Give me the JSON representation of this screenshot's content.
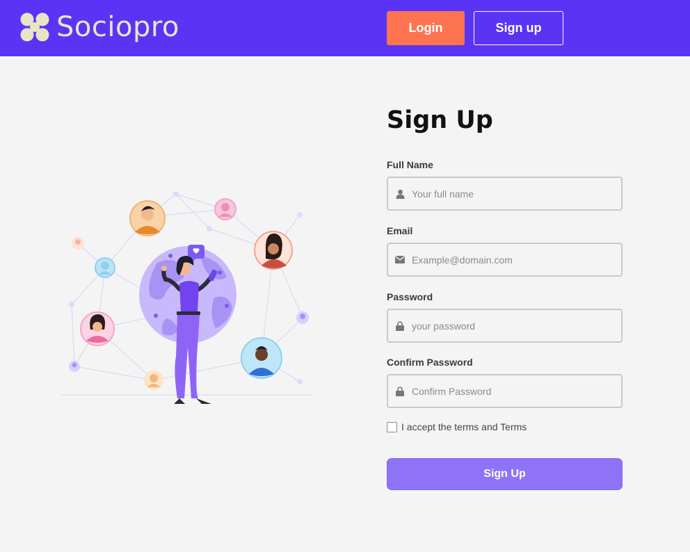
{
  "brand": {
    "name": "Sociopro",
    "logo_color": "#e8e4c8",
    "bar_color": "#5a34f5"
  },
  "nav": {
    "login_label": "Login",
    "signup_label": "Sign up",
    "login_color": "#ff7450"
  },
  "form": {
    "title": "Sign Up",
    "fields": [
      {
        "label": "Full Name",
        "placeholder": "Your full name",
        "icon": "user-icon"
      },
      {
        "label": "Email",
        "placeholder": "Example@domain.com",
        "icon": "envelope-icon"
      },
      {
        "label": "Password",
        "placeholder": "your password",
        "icon": "lock-icon"
      },
      {
        "label": "Confirm Password",
        "placeholder": "Confirm Password",
        "icon": "lock-icon"
      }
    ],
    "terms_label": "I accept the terms and Terms",
    "submit_label": "Sign Up",
    "submit_color": "#8e73f6"
  },
  "illustration": {
    "name": "social-network-illustration"
  }
}
